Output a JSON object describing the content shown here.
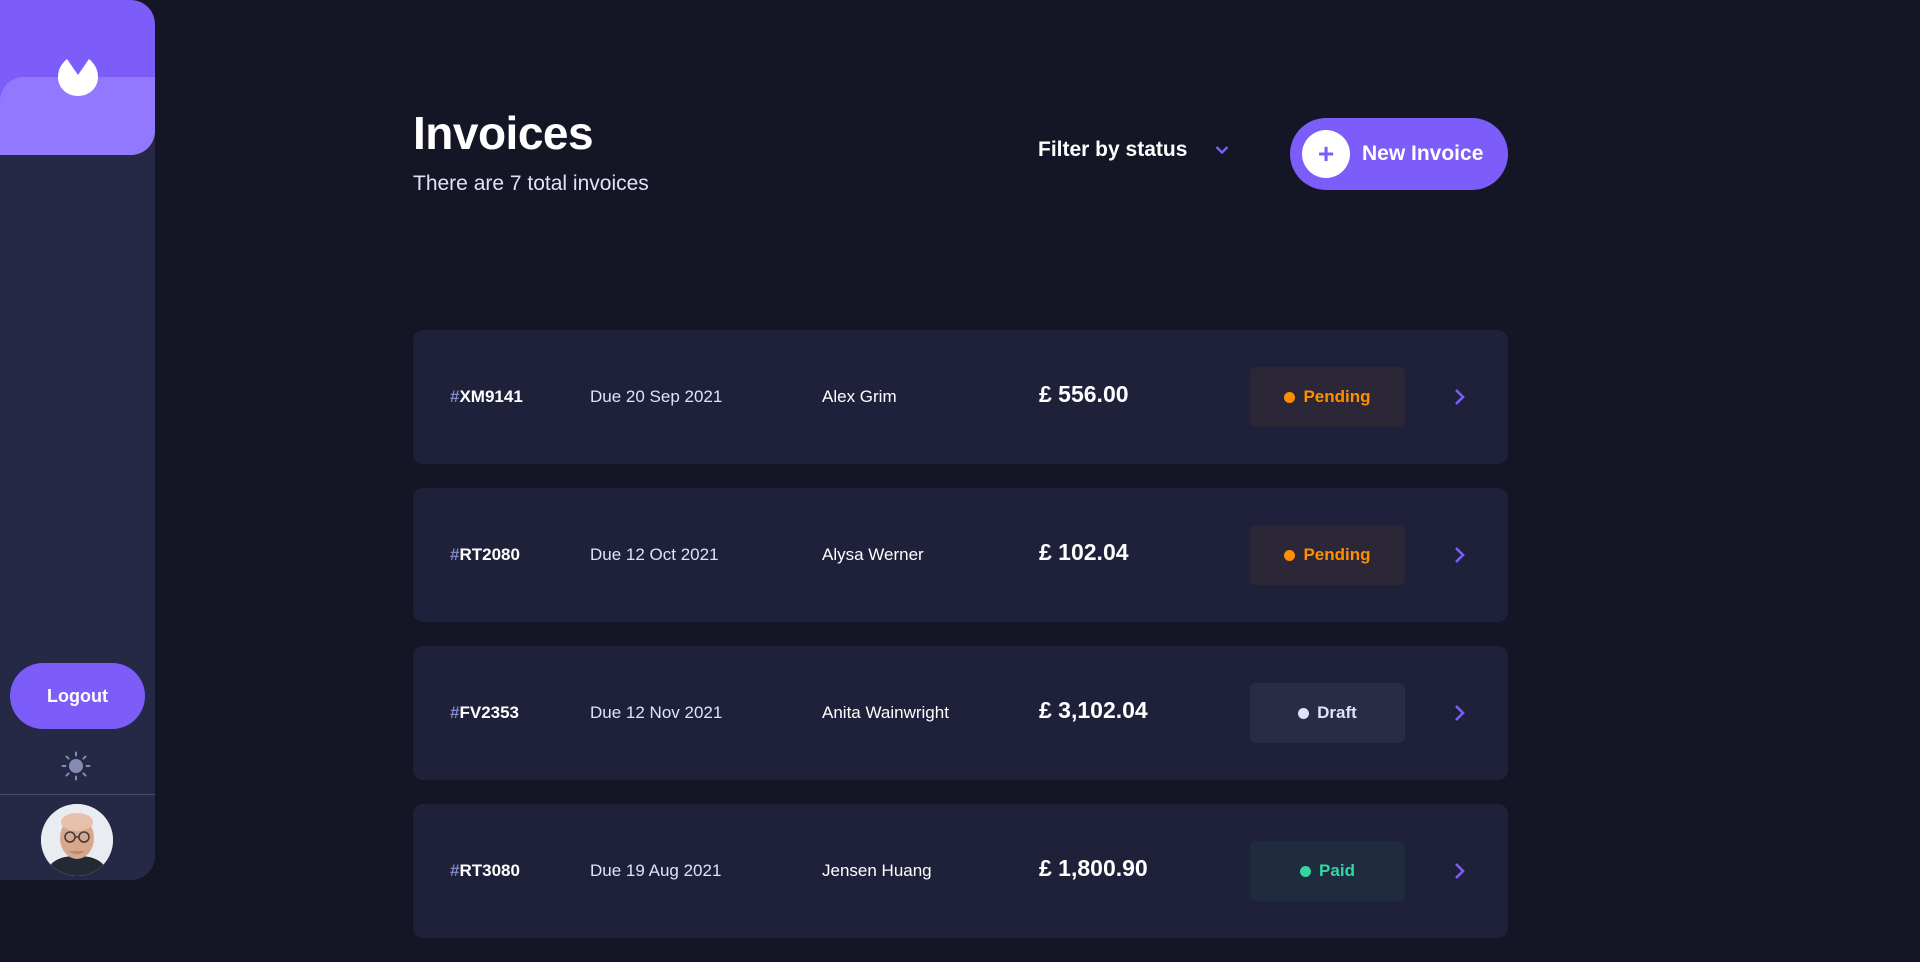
{
  "app": {
    "accent": "#7C5DFA",
    "background": "#141625",
    "card_background": "#1E2139"
  },
  "sidebar": {
    "logo_icon": "logo-icon",
    "logout_label": "Logout",
    "theme_icon": "sun-icon",
    "avatar_icon": "user-avatar"
  },
  "header": {
    "title": "Invoices",
    "subtitle": "There are 7 total invoices",
    "filter_label": "Filter by status",
    "filter_icon": "chevron-down-icon",
    "new_invoice_label": "New Invoice",
    "new_invoice_icon": "+"
  },
  "invoices": [
    {
      "hash": "#",
      "id": "XM9141",
      "due": "Due 20 Sep 2021",
      "client": "Alex Grim",
      "amount": "£ 556.00",
      "status": "Pending"
    },
    {
      "hash": "#",
      "id": "RT2080",
      "due": "Due 12 Oct 2021",
      "client": "Alysa Werner",
      "amount": "£ 102.04",
      "status": "Pending"
    },
    {
      "hash": "#",
      "id": "FV2353",
      "due": "Due 12 Nov 2021",
      "client": "Anita Wainwright",
      "amount": "£ 3,102.04",
      "status": "Draft"
    },
    {
      "hash": "#",
      "id": "RT3080",
      "due": "Due 19 Aug 2021",
      "client": "Jensen Huang",
      "amount": "£ 1,800.90",
      "status": "Paid"
    }
  ],
  "status_colors": {
    "Pending": "#FF8F00",
    "Draft": "#DFE3FA",
    "Paid": "#33D69F"
  }
}
